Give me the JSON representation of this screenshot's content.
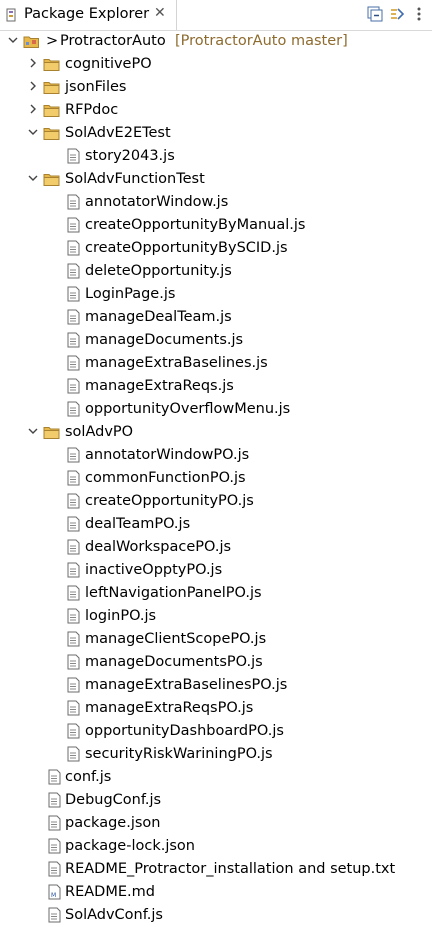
{
  "tab": {
    "title": "Package Explorer",
    "close": "✕"
  },
  "tree": {
    "project": {
      "prefix": ">",
      "name": "ProtractorAuto",
      "decoration": "[ProtractorAuto master]"
    },
    "items": [
      {
        "label": "cognitivePO",
        "type": "folder",
        "expanded": false
      },
      {
        "label": "jsonFiles",
        "type": "folder",
        "expanded": false
      },
      {
        "label": "RFPdoc",
        "type": "folder",
        "expanded": false
      },
      {
        "label": "SolAdvE2ETest",
        "type": "folder",
        "expanded": true,
        "children": [
          "story2043.js"
        ]
      },
      {
        "label": "SolAdvFunctionTest",
        "type": "folder",
        "expanded": true,
        "children": [
          "annotatorWindow.js",
          "createOpportunityByManual.js",
          "createOpportunityBySCID.js",
          "deleteOpportunity.js",
          "LoginPage.js",
          "manageDealTeam.js",
          "manageDocuments.js",
          "manageExtraBaselines.js",
          "manageExtraReqs.js",
          "opportunityOverflowMenu.js"
        ]
      },
      {
        "label": "solAdvPO",
        "type": "folder",
        "expanded": true,
        "children": [
          "annotatorWindowPO.js",
          "commonFunctionPO.js",
          "createOpportunityPO.js",
          "dealTeamPO.js",
          "dealWorkspacePO.js",
          "inactiveOpptyPO.js",
          "leftNavigationPanelPO.js",
          "loginPO.js",
          "manageClientScopePO.js",
          "manageDocumentsPO.js",
          "manageExtraBaselinesPO.js",
          "manageExtraReqsPO.js",
          "opportunityDashboardPO.js",
          "securityRiskWariningPO.js"
        ]
      },
      {
        "label": "conf.js",
        "type": "file"
      },
      {
        "label": "DebugConf.js",
        "type": "file"
      },
      {
        "label": "package.json",
        "type": "file"
      },
      {
        "label": "package-lock.json",
        "type": "file"
      },
      {
        "label": "README_Protractor_installation and setup.txt",
        "type": "file"
      },
      {
        "label": "README.md",
        "type": "file-md"
      },
      {
        "label": "SolAdvConf.js",
        "type": "file"
      }
    ]
  },
  "icons": {
    "tab": "package-explorer-icon",
    "collapse_all": "collapse-all-icon",
    "link_with_editor": "link-with-editor-icon",
    "view_menu": "view-menu-icon"
  },
  "colors": {
    "folder": "#e8b84a",
    "decoration": "#8e6b2f",
    "selection": "#ffffff"
  }
}
